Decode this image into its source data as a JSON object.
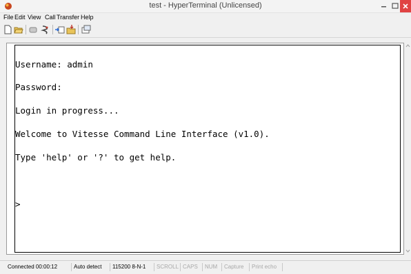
{
  "window": {
    "title": "test - HyperTerminal (Unlicensed)",
    "close_glyph": "×",
    "minimize_glyph": "–"
  },
  "menu": {
    "items": [
      "File",
      "Edit",
      "View",
      "Call",
      "Transfer",
      "Help"
    ]
  },
  "toolbar": {
    "icons": [
      "new-connection-icon",
      "open-icon",
      "disconnect-icon",
      "call-icon",
      "send-icon",
      "receive-icon",
      "properties-icon"
    ]
  },
  "terminal": {
    "lines": [
      "Username: admin",
      "Password:",
      "Login in progress...",
      "Welcome to Vitesse Command Line Interface (v1.0).",
      "Type 'help' or '?' to get help.",
      "",
      ">"
    ]
  },
  "status": {
    "connected": "Connected 00:00:12",
    "detect": "Auto detect",
    "settings": "115200 8-N-1",
    "scroll": "SCROLL",
    "caps": "CAPS",
    "num": "NUM",
    "capture": "Capture",
    "print_echo": "Print echo"
  }
}
